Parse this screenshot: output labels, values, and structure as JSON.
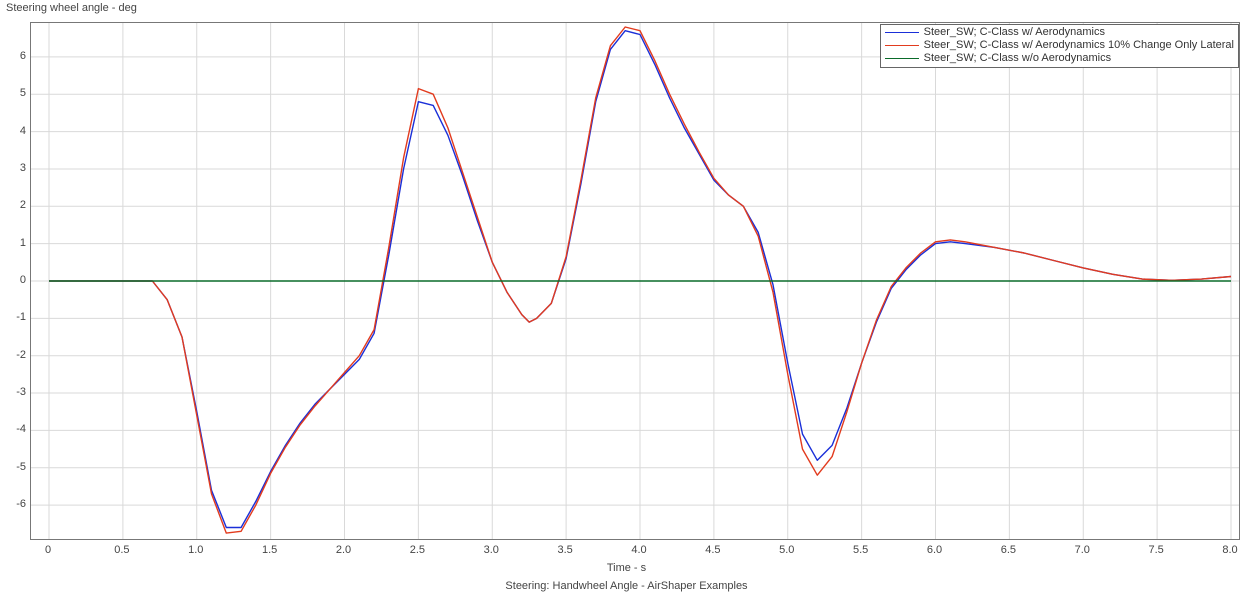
{
  "chart_data": {
    "type": "line",
    "title": "",
    "subtitle": "Steering: Handwheel Angle - AirShaper Examples",
    "ylabel": "Steering wheel angle - deg",
    "xlabel": "Time - s",
    "xlim": [
      0,
      8.0
    ],
    "ylim": [
      -6.8,
      6.8
    ],
    "xticks": [
      0,
      0.5,
      1.0,
      1.5,
      2.0,
      2.5,
      3.0,
      3.5,
      4.0,
      4.5,
      5.0,
      5.5,
      6.0,
      6.5,
      7.0,
      7.5,
      8.0
    ],
    "yticks": [
      -6,
      -5,
      -4,
      -3,
      -2,
      -1,
      0,
      1,
      2,
      3,
      4,
      5,
      6
    ],
    "legend_position": "top-right",
    "grid": true,
    "x": [
      0,
      0.5,
      0.7,
      0.8,
      0.9,
      1.0,
      1.1,
      1.2,
      1.3,
      1.4,
      1.5,
      1.6,
      1.7,
      1.8,
      1.9,
      2.0,
      2.1,
      2.2,
      2.3,
      2.4,
      2.5,
      2.6,
      2.7,
      2.8,
      2.9,
      3.0,
      3.1,
      3.2,
      3.25,
      3.3,
      3.4,
      3.5,
      3.6,
      3.7,
      3.8,
      3.9,
      4.0,
      4.1,
      4.2,
      4.3,
      4.4,
      4.5,
      4.6,
      4.7,
      4.8,
      4.9,
      5.0,
      5.1,
      5.2,
      5.3,
      5.4,
      5.5,
      5.6,
      5.7,
      5.8,
      5.9,
      6.0,
      6.1,
      6.2,
      6.4,
      6.6,
      6.8,
      7.0,
      7.2,
      7.4,
      7.6,
      7.8,
      8.0
    ],
    "series": [
      {
        "name": "Steer_SW; C-Class w/ Aerodynamics",
        "color": "#1a2fd8",
        "values": [
          0,
          0,
          0,
          -0.5,
          -1.5,
          -3.5,
          -5.6,
          -6.6,
          -6.6,
          -5.9,
          -5.1,
          -4.4,
          -3.8,
          -3.3,
          -2.9,
          -2.5,
          -2.1,
          -1.4,
          0.7,
          3.0,
          4.8,
          4.7,
          3.9,
          2.8,
          1.6,
          0.5,
          -0.3,
          -0.9,
          -1.1,
          -1.0,
          -0.6,
          0.6,
          2.6,
          4.8,
          6.2,
          6.7,
          6.6,
          5.8,
          4.9,
          4.1,
          3.4,
          2.7,
          2.3,
          2.0,
          1.3,
          -0.1,
          -2.2,
          -4.1,
          -4.8,
          -4.4,
          -3.4,
          -2.2,
          -1.1,
          -0.2,
          0.3,
          0.7,
          1.0,
          1.05,
          1.0,
          0.9,
          0.75,
          0.55,
          0.35,
          0.18,
          0.05,
          0.02,
          0.05,
          0.12
        ]
      },
      {
        "name": "Steer_SW; C-Class w/ Aerodynamics 10% Change Only Lateral",
        "color": "#e23b1e",
        "values": [
          0,
          0,
          0,
          -0.5,
          -1.5,
          -3.6,
          -5.7,
          -6.75,
          -6.7,
          -6.0,
          -5.15,
          -4.45,
          -3.85,
          -3.35,
          -2.9,
          -2.45,
          -2.0,
          -1.3,
          0.9,
          3.3,
          5.15,
          5.0,
          4.1,
          2.9,
          1.7,
          0.5,
          -0.3,
          -0.9,
          -1.1,
          -1.0,
          -0.6,
          0.65,
          2.7,
          4.9,
          6.3,
          6.8,
          6.7,
          5.9,
          5.0,
          4.2,
          3.45,
          2.75,
          2.3,
          2.0,
          1.2,
          -0.3,
          -2.5,
          -4.5,
          -5.2,
          -4.7,
          -3.5,
          -2.2,
          -1.05,
          -0.15,
          0.35,
          0.75,
          1.05,
          1.1,
          1.05,
          0.9,
          0.75,
          0.55,
          0.35,
          0.18,
          0.05,
          0.02,
          0.05,
          0.12
        ]
      },
      {
        "name": "Steer_SW; C-Class w/o Aerodynamics",
        "color": "#0a6b2a",
        "values": [
          0,
          0,
          0,
          0,
          0,
          0,
          0,
          0,
          0,
          0,
          0,
          0,
          0,
          0,
          0,
          0,
          0,
          0,
          0,
          0,
          0,
          0,
          0,
          0,
          0,
          0,
          0,
          0,
          0,
          0,
          0,
          0,
          0,
          0,
          0,
          0,
          0,
          0,
          0,
          0,
          0,
          0,
          0,
          0,
          0,
          0,
          0,
          0,
          0,
          0,
          0,
          0,
          0,
          0,
          0,
          0,
          0,
          0,
          0,
          0,
          0,
          0,
          0,
          0,
          0,
          0,
          0,
          0
        ]
      }
    ]
  }
}
